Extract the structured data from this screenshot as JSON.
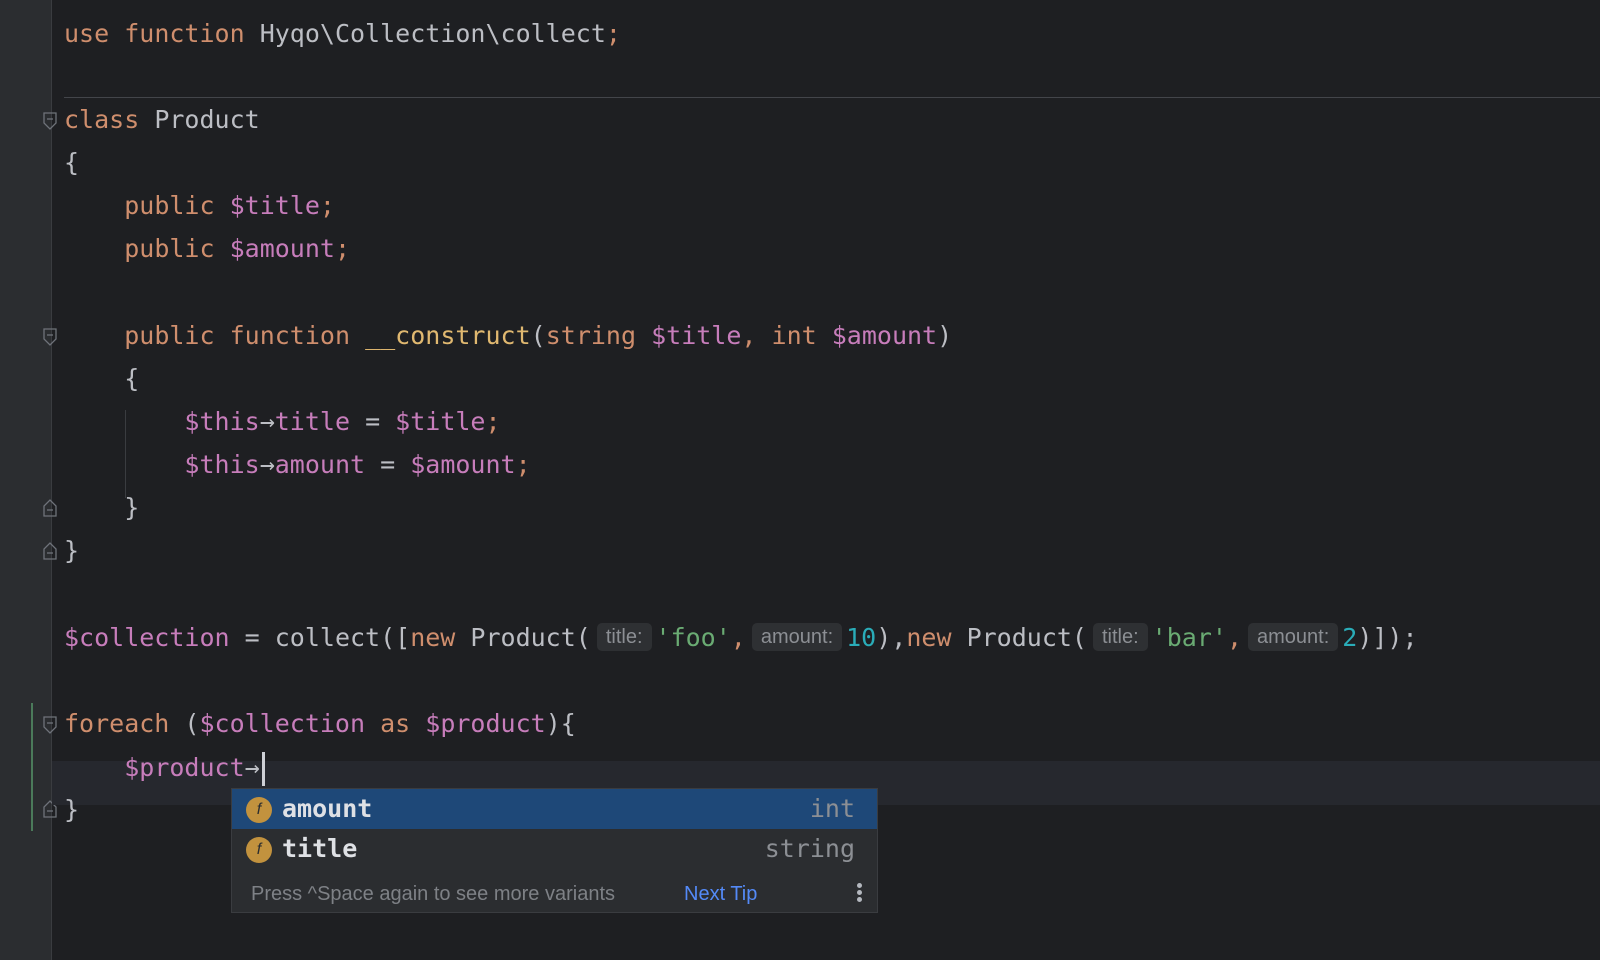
{
  "code": {
    "line_use": {
      "kw1": "use",
      "kw2": "function",
      "path": "Hyqo\\Collection\\collect",
      "semi": ";"
    },
    "line_class": {
      "kw": "class",
      "name": "Product"
    },
    "brace_open": "{",
    "prop1": {
      "kw": "public",
      "var": "$title",
      "semi": ";"
    },
    "prop2": {
      "kw": "public",
      "var": "$amount",
      "semi": ";"
    },
    "ctor": {
      "kw1": "public",
      "kw2": "function",
      "name": "__construct",
      "open": "(",
      "t1": "string",
      "p1": "$title",
      "comma": ",",
      "t2": "int",
      "p2": "$amount",
      "close": ")"
    },
    "ctor_brace_open": "{",
    "assign1": {
      "this": "$this",
      "arrow": "→",
      "prop": "title",
      "eq": " = ",
      "var": "$title",
      "semi": ";"
    },
    "assign2": {
      "this": "$this",
      "arrow": "→",
      "prop": "amount",
      "eq": " = ",
      "var": "$amount",
      "semi": ";"
    },
    "ctor_brace_close": "}",
    "brace_close": "}",
    "collection": {
      "var": "$collection",
      "eq": " = ",
      "fn": "collect",
      "open": "([",
      "new1": "new",
      "cls1": "Product",
      "paren1": "(",
      "hint_title1": "title:",
      "str1": "'foo'",
      "comma1": ",",
      "hint_amount1": "amount:",
      "num1": "10",
      "close1": "),",
      "new2": "new",
      "cls2": "Product",
      "paren2": "(",
      "hint_title2": "title:",
      "str2": "'bar'",
      "comma2": ",",
      "hint_amount2": "amount:",
      "num2": "2",
      "close2": ")]);"
    },
    "foreach": {
      "kw": "foreach",
      "open": " (",
      "var1": "$collection",
      "as": " as ",
      "var2": "$product",
      "close": "){"
    },
    "product_line": {
      "var": "$product",
      "arrow": "→"
    },
    "foreach_close": "}"
  },
  "completion": {
    "items": [
      {
        "icon": "f",
        "name": "amount",
        "type": "int"
      },
      {
        "icon": "f",
        "name": "title",
        "type": "string"
      }
    ],
    "footer_hint": "Press ^Space again to see more variants",
    "next_tip": "Next Tip"
  }
}
